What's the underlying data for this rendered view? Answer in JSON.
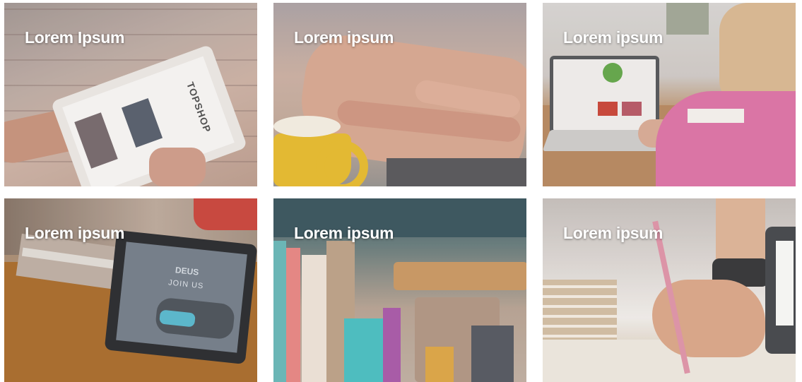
{
  "gallery": {
    "items": [
      {
        "caption": "Lorem Ipsum",
        "icon": "tablet-in-hand-photo"
      },
      {
        "caption": "Lorem ipsum",
        "icon": "hands-typing-photo"
      },
      {
        "caption": "Lorem ipsum",
        "icon": "woman-laptop-photo"
      },
      {
        "caption": "Lorem ipsum",
        "icon": "tablet-on-desk-photo"
      },
      {
        "caption": "Lorem ipsum",
        "icon": "books-closeup-photo"
      },
      {
        "caption": "Lorem ipsum",
        "icon": "hand-writing-photo"
      }
    ],
    "photo_text": {
      "tablet_brand": "TOPSHOP",
      "tablet_screen_title": "JOIN US",
      "tablet_logo": "DEUS"
    }
  }
}
